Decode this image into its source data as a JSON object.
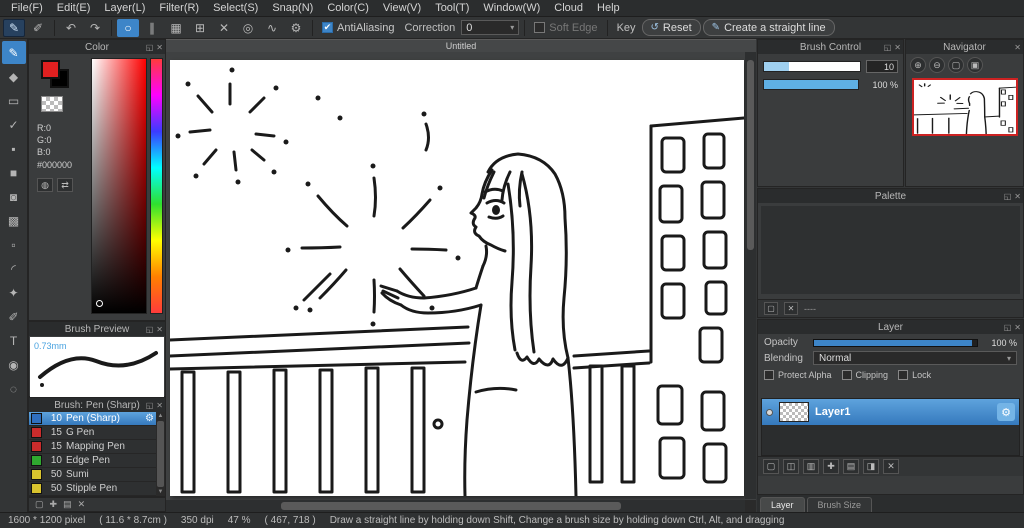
{
  "colors": {
    "accent": "#3d85c8",
    "selection_top": "#5ea3dd",
    "selection_bottom": "#3579bd",
    "navigator_border": "#cc2222",
    "ink": "#1a1a1a"
  },
  "menu": {
    "items": [
      "File(F)",
      "Edit(E)",
      "Layer(L)",
      "Filter(R)",
      "Select(S)",
      "Snap(N)",
      "Color(C)",
      "View(V)",
      "Tool(T)",
      "Window(W)",
      "Cloud",
      "Help"
    ]
  },
  "toolbar": {
    "brush_icon": "✎",
    "pen_icon": "✐",
    "undo_icon": "↶",
    "redo_icon": "↷",
    "snap_icons": [
      "○",
      "∥",
      "▦",
      "⊞",
      "✕",
      "◎",
      "∿",
      "⚙"
    ],
    "antialiasing_label": "AntiAliasing",
    "check_icon": "✔",
    "correction_label": "Correction",
    "correction_value": "0",
    "dropdown_arrow": "▾",
    "soft_edge_label": "Soft Edge",
    "key_label": "Key",
    "reset_icon": "↺",
    "reset_label": "Reset",
    "straight_line_icon": "✎",
    "straight_line_label": "Create a straight line"
  },
  "tools": {
    "glyphs": [
      "✎",
      "◆",
      "▭",
      "✓",
      "▪",
      "■",
      "◙",
      "▩",
      "▫",
      "◜",
      "✦",
      "✐",
      "T",
      "◉",
      "◌"
    ]
  },
  "color_panel": {
    "title": "Color",
    "popout_icon": "◱",
    "close_icon": "✕",
    "r": "R:0",
    "g": "G:0",
    "b": "B:0",
    "hex": "#000000",
    "wheel_icon": "◍",
    "swap_icon": "⇄"
  },
  "brush_preview": {
    "title": "Brush Preview",
    "popout_icon": "◱",
    "close_icon": "✕",
    "size": "0.73mm"
  },
  "brush_list": {
    "title": "Brush: Pen (Sharp)",
    "popout_icon": "◱",
    "close_icon": "✕",
    "gear_icon": "⚙",
    "scroll_up_icon": "▲",
    "scroll_down_icon": "▼",
    "items": [
      {
        "size": "10",
        "name": "Pen (Sharp)",
        "chip": "#2f6fbf"
      },
      {
        "size": "15",
        "name": "G Pen",
        "chip": "#c92c2c"
      },
      {
        "size": "15",
        "name": "Mapping Pen",
        "chip": "#c92c2c"
      },
      {
        "size": "10",
        "name": "Edge Pen",
        "chip": "#2fa82f"
      },
      {
        "size": "50",
        "name": "Sumi",
        "chip": "#d8c32e"
      },
      {
        "size": "50",
        "name": "Stipple Pen",
        "chip": "#d8c32e"
      }
    ],
    "footer_icons": [
      "▢",
      "✚",
      "▤",
      "✕"
    ]
  },
  "canvas": {
    "tab": "Untitled"
  },
  "brush_control": {
    "title": "Brush Control",
    "popout_icon": "◱",
    "close_icon": "✕",
    "size_value": "10",
    "opacity_value": "100 %"
  },
  "navigator": {
    "title": "Navigator",
    "close_icon": "✕",
    "zoom_icons": [
      "⊕",
      "⊖",
      "▢",
      "▣"
    ]
  },
  "palette": {
    "title": "Palette",
    "popout_icon": "◱",
    "close_icon": "✕",
    "new_icon": "▢",
    "trash_icon": "✕",
    "dash": "----"
  },
  "layer": {
    "title": "Layer",
    "popout_icon": "◱",
    "close_icon": "✕",
    "opacity_label": "Opacity",
    "opacity_value": "100 %",
    "blending_label": "Blending",
    "blending_value": "Normal",
    "dropdown_arrow": "▾",
    "protect_alpha_label": "Protect Alpha",
    "clipping_label": "Clipping",
    "lock_label": "Lock",
    "layer_name": "Layer1",
    "gear_icon": "⚙",
    "bottom_icons": [
      "▢",
      "◫",
      "▥",
      "✚",
      "▤",
      "◨",
      "✕"
    ]
  },
  "right_tabs": {
    "layer": "Layer",
    "brush_size": "Brush Size"
  },
  "status": {
    "size": "1600 * 1200 pixel",
    "cm": "( 11.6 * 8.7cm )",
    "dpi": "350 dpi",
    "zoom": "47 %",
    "coords": "( 467, 718 )",
    "hint": "Draw a straight line by holding down Shift, Change a brush size by holding down Ctrl, Alt, and dragging"
  }
}
